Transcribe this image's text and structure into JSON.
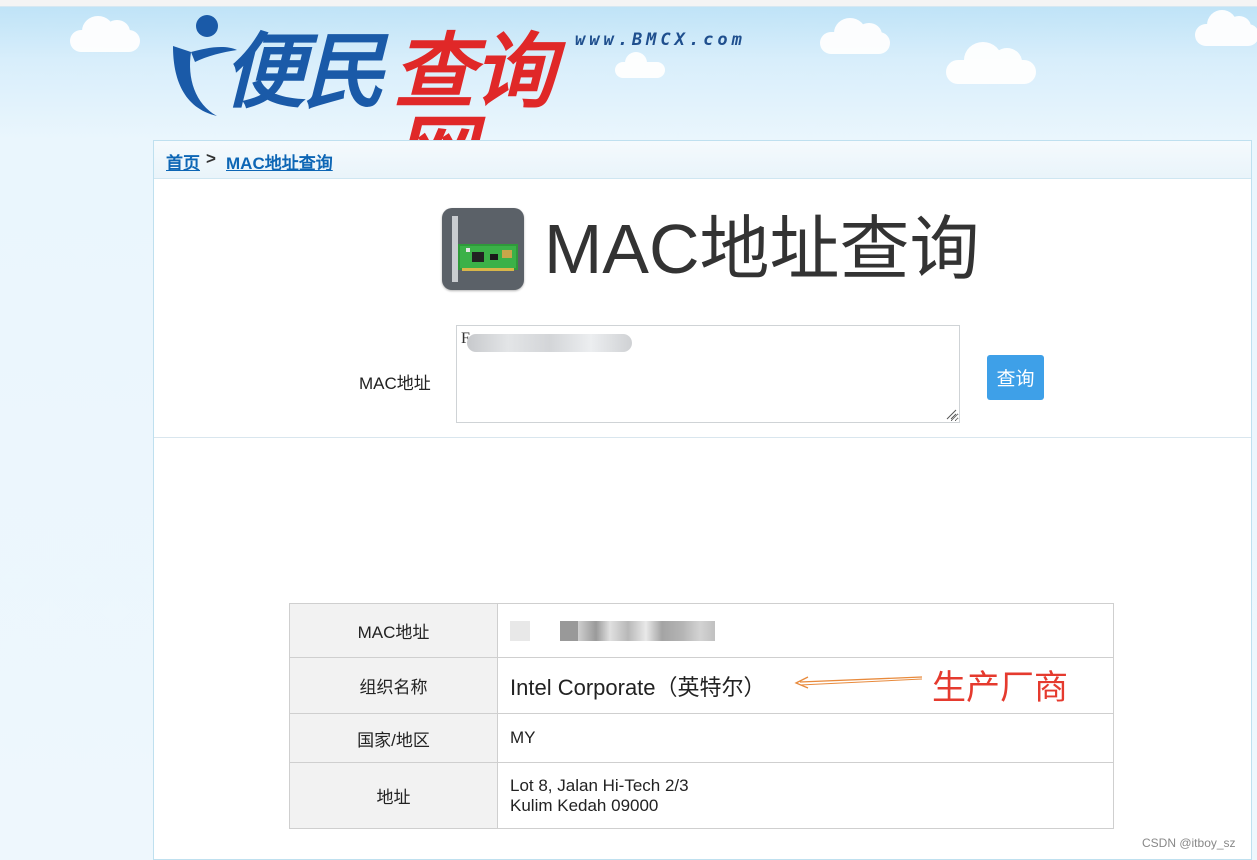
{
  "header": {
    "logo_url_text": "www.BMCX.com",
    "logo_main_blue": "便民",
    "logo_main_red": "查询网"
  },
  "breadcrumb": {
    "home": "首页",
    "separator": ">",
    "current": "MAC地址查询"
  },
  "page": {
    "title": "MAC地址查询",
    "icon": "network-card-icon"
  },
  "form": {
    "mac_label": "MAC地址",
    "mac_value_prefix": "F",
    "submit_label": "查询"
  },
  "result": {
    "rows": [
      {
        "key": "MAC地址",
        "value": ""
      },
      {
        "key": "组织名称",
        "value": "Intel Corporate（英特尔）"
      },
      {
        "key": "国家/地区",
        "value": "MY"
      },
      {
        "key": "地址",
        "value_line1": "Lot 8, Jalan Hi-Tech 2/3",
        "value_line2": "Kulim Kedah 09000"
      }
    ]
  },
  "annotation": {
    "text": "生产厂商",
    "color": "#e53a2e"
  },
  "watermark": "CSDN @itboy_sz",
  "colors": {
    "accent_button": "#3ea0e8",
    "link": "#0d66b5",
    "logo_blue": "#1a5aa8",
    "logo_red": "#e02828"
  }
}
